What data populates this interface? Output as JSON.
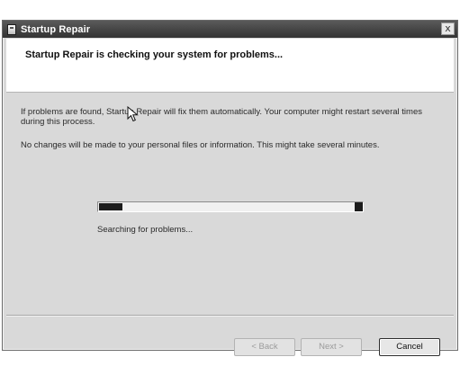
{
  "window": {
    "title": "Startup Repair",
    "close_glyph": "x"
  },
  "header": {
    "heading": "Startup Repair is checking your system for problems..."
  },
  "body": {
    "paragraph1": "If problems are found, Startup Repair will fix them automatically. Your computer might restart several times during this process.",
    "paragraph2": "No changes will be made to your personal files or information. This might take several minutes."
  },
  "progress": {
    "fraction": 0.09,
    "status": "Searching for problems..."
  },
  "buttons": {
    "back": "< Back",
    "next": "Next >",
    "cancel": "Cancel"
  },
  "icons": {
    "title": "app-window-icon",
    "close": "close-icon",
    "cursor": "mouse-pointer-icon"
  }
}
